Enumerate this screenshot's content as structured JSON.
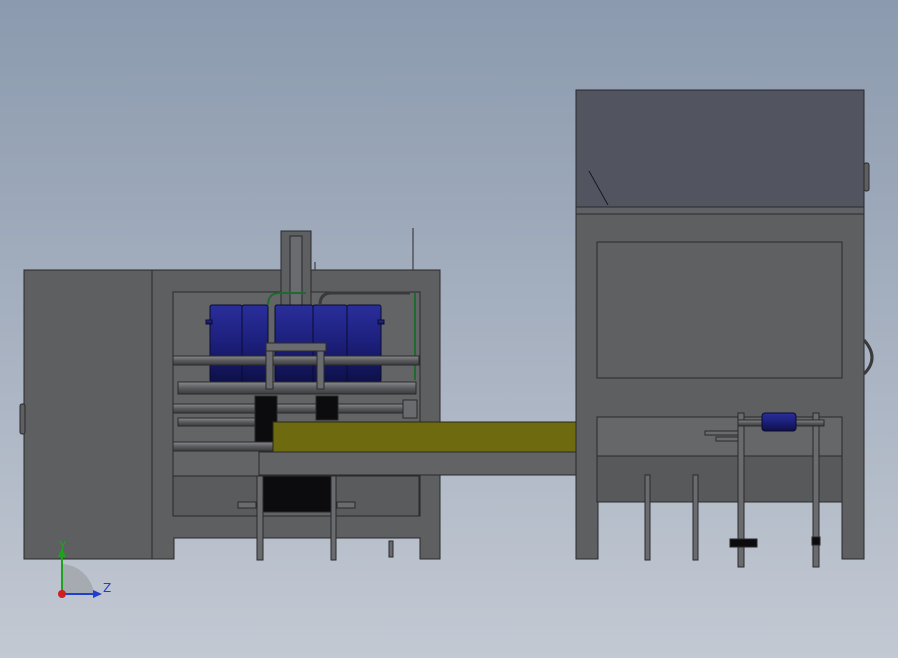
{
  "viewport": {
    "background_top": "#8b9aae",
    "background_bottom": "#c3c9d3",
    "model_fill": "#5e5f61",
    "model_edge": "#2a2a2c",
    "cylinder_color": "#1c1f7a",
    "belt_color": "#6e6a10"
  },
  "triad": {
    "y_label": "Y",
    "z_label": "Z",
    "y_color": "#1fa31f",
    "z_color": "#1f3fd0",
    "x_color": "#d01f1f"
  }
}
